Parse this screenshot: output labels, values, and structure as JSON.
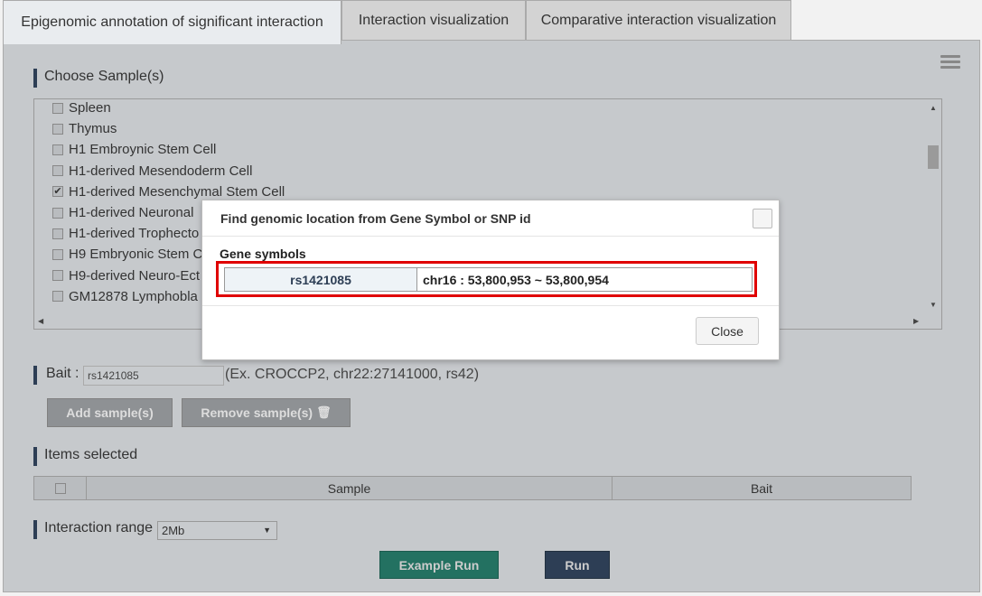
{
  "tabs": [
    {
      "label": "Epigenomic annotation of significant interaction",
      "active": true
    },
    {
      "label": "Interaction visualization",
      "active": false
    },
    {
      "label": "Comparative interaction visualization",
      "active": false
    }
  ],
  "menu_icon": "hamburger-menu-icon",
  "choose_samples": {
    "title": "Choose Sample(s)",
    "items": [
      {
        "label": "Spleen",
        "checked": false
      },
      {
        "label": "Thymus",
        "checked": false
      },
      {
        "label": "H1 Embroynic Stem Cell",
        "checked": false
      },
      {
        "label": "H1-derived Mesendoderm Cell",
        "checked": false
      },
      {
        "label": "H1-derived Mesenchymal Stem Cell",
        "checked": true
      },
      {
        "label": "H1-derived Neuronal",
        "checked": false
      },
      {
        "label": "H1-derived Trophecto",
        "checked": false
      },
      {
        "label": "H9 Embryonic Stem C",
        "checked": false
      },
      {
        "label": "H9-derived Neuro-Ect",
        "checked": false
      },
      {
        "label": "GM12878 Lymphobla",
        "checked": false
      }
    ]
  },
  "bait": {
    "label": "Bait :",
    "value": "rs1421085",
    "hint": "(Ex. CROCCP2, chr22:27141000, rs42)"
  },
  "buttons": {
    "add": "Add sample(s)",
    "remove": "Remove sample(s)",
    "example_run": "Example Run",
    "run": "Run"
  },
  "items_selected": {
    "title": "Items selected",
    "columns": [
      "Sample",
      "Bait"
    ]
  },
  "interaction_range": {
    "label": "Interaction range",
    "value": "2Mb"
  },
  "modal": {
    "title": "Find genomic location from Gene Symbol or SNP id",
    "section_label": "Gene symbols",
    "result_id": "rs1421085",
    "result_location": "chr16 : 53,800,953 ~ 53,800,954",
    "close_label": "Close"
  },
  "colors": {
    "highlight_border": "#e00000",
    "example_run_bg": "#237161",
    "run_bg": "#2d3e55"
  }
}
